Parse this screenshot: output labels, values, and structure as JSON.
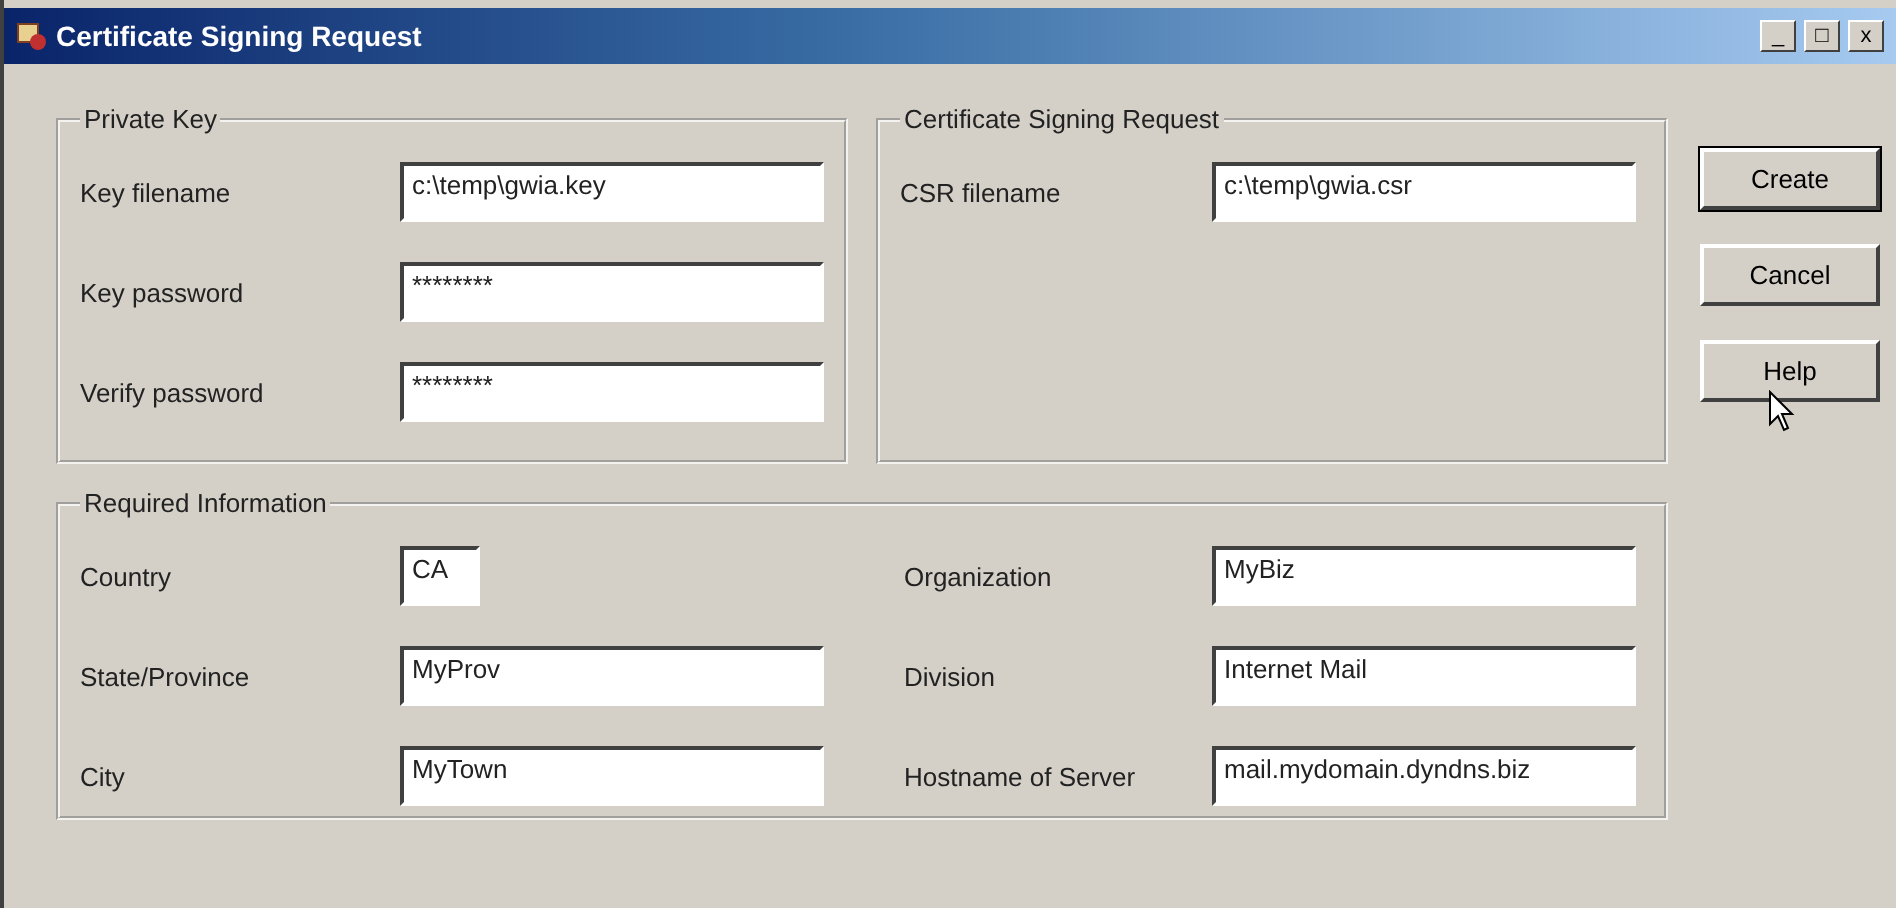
{
  "window": {
    "title": "Certificate Signing Request",
    "controls": [
      "_",
      "□",
      "x"
    ]
  },
  "private_key": {
    "title": "Private Key",
    "fields": [
      {
        "label": "Key filename",
        "value": "c:\\temp\\gwia.key"
      },
      {
        "label": "Key password",
        "value": "********"
      },
      {
        "label": "Verify password",
        "value": "********"
      }
    ]
  },
  "csr": {
    "title": "Certificate Signing Request",
    "fields": [
      {
        "label": "CSR filename",
        "value": "c:\\temp\\gwia.csr"
      }
    ]
  },
  "buttons": [
    {
      "label": "Create",
      "focused": true
    },
    {
      "label": "Cancel",
      "focused": false
    },
    {
      "label": "Help",
      "focused": false
    }
  ],
  "required": {
    "title": "Required Information",
    "left": [
      {
        "label": "Country",
        "value": "CA",
        "kind": "short"
      },
      {
        "label": "State/Province",
        "value": "MyProv",
        "kind": "wide"
      },
      {
        "label": "City",
        "value": "MyTown",
        "kind": "wide"
      }
    ],
    "right": [
      {
        "label": "Organization",
        "value": "MyBiz"
      },
      {
        "label": "Division",
        "value": "Internet Mail"
      },
      {
        "label": "Hostname of Server",
        "value": "mail.mydomain.dyndns.biz"
      }
    ]
  }
}
